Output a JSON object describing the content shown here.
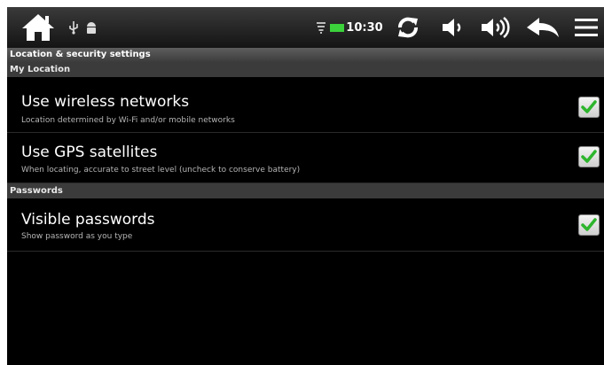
{
  "status_bar": {
    "time": "10:30",
    "icons": [
      "home-icon",
      "usb-icon",
      "android-debug-icon",
      "wifi-icon",
      "battery-icon",
      "sync-icon",
      "volume-down-icon",
      "volume-up-icon",
      "back-arrow-icon",
      "menu-icon"
    ],
    "battery_color": "#3bd23b"
  },
  "screen": {
    "title": "Location & security settings"
  },
  "sections": [
    {
      "header": "My Location",
      "items": [
        {
          "title": "Use wireless networks",
          "summary": "Location determined by Wi-Fi and/or mobile networks",
          "checked": true
        },
        {
          "title": "Use GPS satellites",
          "summary": "When locating, accurate to street level (uncheck to conserve battery)",
          "checked": true
        }
      ]
    },
    {
      "header": "Passwords",
      "items": [
        {
          "title": "Visible passwords",
          "summary": "Show password as you type",
          "checked": true
        }
      ]
    }
  ],
  "colors": {
    "check_green": "#2db52d",
    "background": "#000000",
    "section_header": "#3b3b3b"
  }
}
